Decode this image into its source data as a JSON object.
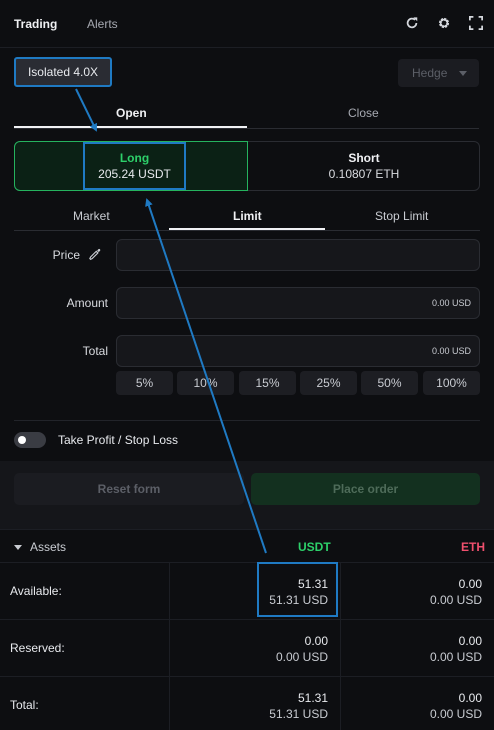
{
  "header": {
    "tabs": [
      {
        "label": "Trading"
      },
      {
        "label": "Alerts"
      }
    ],
    "icons": [
      "refresh-icon",
      "gear-icon",
      "expand-icon"
    ]
  },
  "margin": {
    "label": "Isolated 4.0X"
  },
  "hedge": {
    "label": "Hedge"
  },
  "position_tabs": {
    "open": "Open",
    "close": "Close"
  },
  "side": {
    "long": {
      "label": "Long",
      "value": "205.24 USDT"
    },
    "short": {
      "label": "Short",
      "value": "0.10807 ETH"
    }
  },
  "order_types": {
    "market": "Market",
    "limit": "Limit",
    "stop_limit": "Stop Limit"
  },
  "form": {
    "price_label": "Price",
    "amount_label": "Amount",
    "amount_unit": "0.00 USD",
    "total_label": "Total",
    "total_unit": "0.00 USD",
    "percents": [
      "5%",
      "10%",
      "15%",
      "25%",
      "50%",
      "100%"
    ]
  },
  "tpsl": {
    "label": "Take Profit / Stop Loss",
    "enabled": false
  },
  "actions": {
    "reset": "Reset form",
    "place": "Place order"
  },
  "assets": {
    "title": "Assets",
    "columns": [
      "USDT",
      "ETH"
    ],
    "rows": [
      {
        "label": "Available:",
        "usdt": "51.31",
        "usdt_usd": "51.31 USD",
        "eth": "0.00",
        "eth_usd": "0.00 USD"
      },
      {
        "label": "Reserved:",
        "usdt": "0.00",
        "usdt_usd": "0.00 USD",
        "eth": "0.00",
        "eth_usd": "0.00 USD"
      },
      {
        "label": "Total:",
        "usdt": "51.31",
        "usdt_usd": "51.31 USD",
        "eth": "0.00",
        "eth_usd": "0.00 USD"
      }
    ]
  },
  "colors": {
    "accent_green": "#2dd06a",
    "accent_red": "#f0506e",
    "annotation_blue": "#1f7ac3"
  }
}
